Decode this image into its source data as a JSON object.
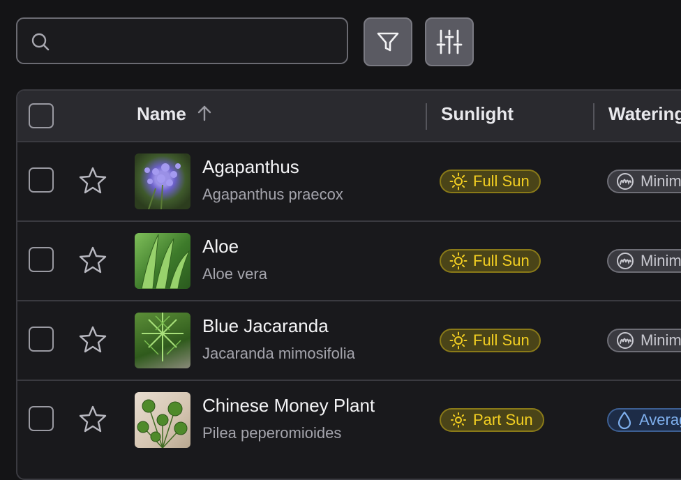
{
  "search": {
    "placeholder": "",
    "value": ""
  },
  "toolbar": {
    "filter_icon": "filter-icon",
    "columns_icon": "sliders-icon"
  },
  "table": {
    "headers": {
      "name": "Name",
      "sunlight": "Sunlight",
      "watering": "Watering"
    },
    "sort": {
      "column": "Name",
      "direction": "ascending"
    },
    "rows": [
      {
        "name": "Agapanthus",
        "scientific": "Agapanthus praecox",
        "sunlight": "Full Sun",
        "watering": "Minimum",
        "watering_style": "gray"
      },
      {
        "name": "Aloe",
        "scientific": "Aloe vera",
        "sunlight": "Full Sun",
        "watering": "Minimum",
        "watering_style": "gray"
      },
      {
        "name": "Blue Jacaranda",
        "scientific": "Jacaranda mimosifolia",
        "sunlight": "Full Sun",
        "watering": "Minimum",
        "watering_style": "gray"
      },
      {
        "name": "Chinese Money Plant",
        "scientific": "Pilea peperomioides",
        "sunlight": "Part Sun",
        "watering": "Average",
        "watering_style": "blue"
      }
    ]
  },
  "colors": {
    "background": "#141416",
    "header": "#2a2a2f",
    "sun_badge_text": "#f3cf22",
    "water_badge_blue": "#7fb0ee"
  }
}
